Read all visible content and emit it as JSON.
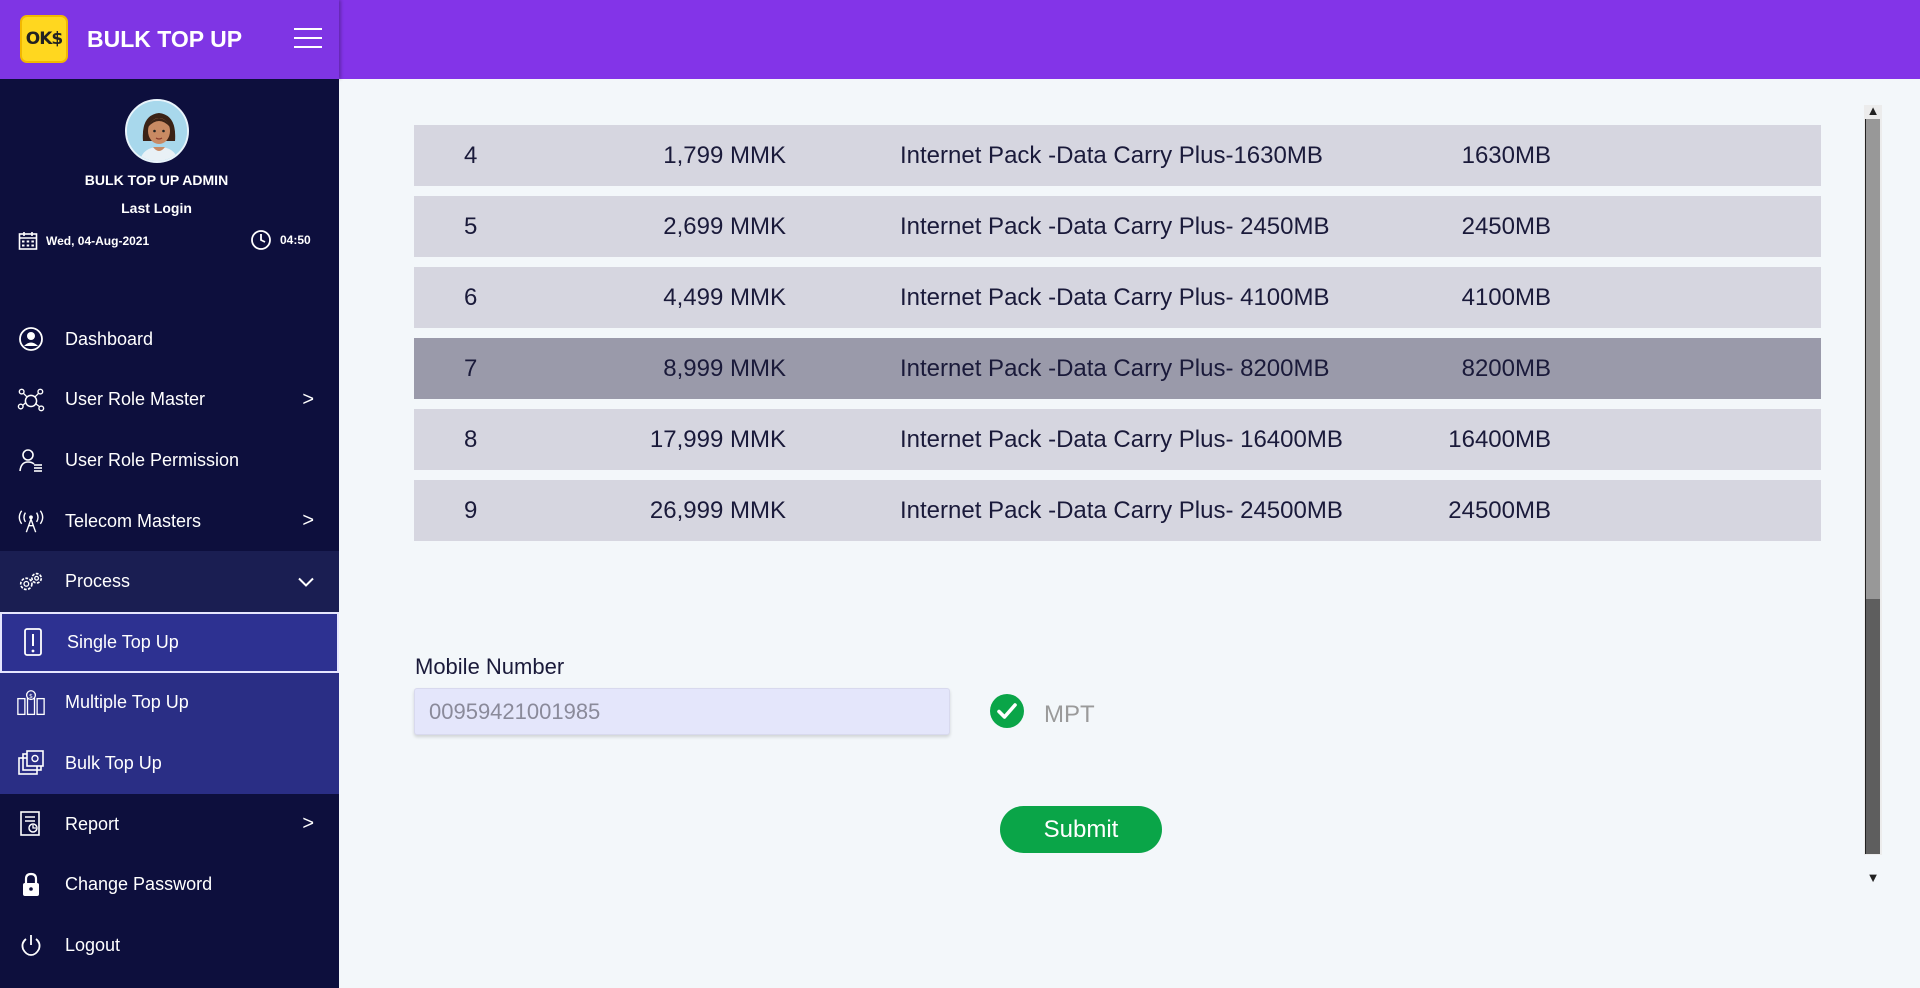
{
  "app": {
    "title": "BULK TOP UP",
    "logo_text": "OK$"
  },
  "user": {
    "name": "BULK TOP UP ADMIN",
    "last_login_label": "Last Login",
    "date": "Wed, 04-Aug-2021",
    "time": "04:50"
  },
  "nav": {
    "items": [
      {
        "label": "Dashboard",
        "icon": "user-circle-icon"
      },
      {
        "label": "User Role Master",
        "icon": "network-icon",
        "chevron": ">"
      },
      {
        "label": "User Role Permission",
        "icon": "user-list-icon"
      },
      {
        "label": "Telecom Masters",
        "icon": "antenna-icon",
        "chevron": ">"
      },
      {
        "label": "Process",
        "icon": "gears-icon",
        "chevron": "⌄"
      },
      {
        "label": "Single Top Up",
        "icon": "phone-icon"
      },
      {
        "label": "Multiple Top Up",
        "icon": "multi-topup-icon"
      },
      {
        "label": "Bulk Top Up",
        "icon": "bulk-topup-icon"
      },
      {
        "label": "Report",
        "icon": "report-icon",
        "chevron": ">"
      },
      {
        "label": "Change Password",
        "icon": "lock-icon"
      },
      {
        "label": "Logout",
        "icon": "power-icon"
      }
    ]
  },
  "packages": [
    {
      "no": "4",
      "price": "1,799 MMK",
      "desc": "Internet Pack -Data Carry Plus-1630MB",
      "size": "1630MB"
    },
    {
      "no": "5",
      "price": "2,699 MMK",
      "desc": "Internet Pack -Data Carry Plus- 2450MB",
      "size": "2450MB"
    },
    {
      "no": "6",
      "price": "4,499 MMK",
      "desc": "Internet Pack -Data Carry Plus- 4100MB",
      "size": "4100MB"
    },
    {
      "no": "7",
      "price": "8,999 MMK",
      "desc": "Internet Pack -Data Carry Plus- 8200MB",
      "size": "8200MB"
    },
    {
      "no": "8",
      "price": "17,999 MMK",
      "desc": "Internet Pack -Data Carry Plus- 16400MB",
      "size": "16400MB"
    },
    {
      "no": "9",
      "price": "26,999 MMK",
      "desc": "Internet Pack -Data Carry Plus- 24500MB",
      "size": "24500MB"
    }
  ],
  "selected_row_index": 3,
  "form": {
    "mobile_label": "Mobile Number",
    "mobile_value": "00959421001985",
    "operator": "MPT",
    "submit_label": "Submit"
  },
  "colors": {
    "topbar": "#8334e8",
    "sidebar": "#0d0f3d",
    "submenu": "#2a2e85",
    "row": "#d6d6e0",
    "row_selected": "#9a9aaa",
    "submit": "#0aa548",
    "check": "#0aa548"
  }
}
